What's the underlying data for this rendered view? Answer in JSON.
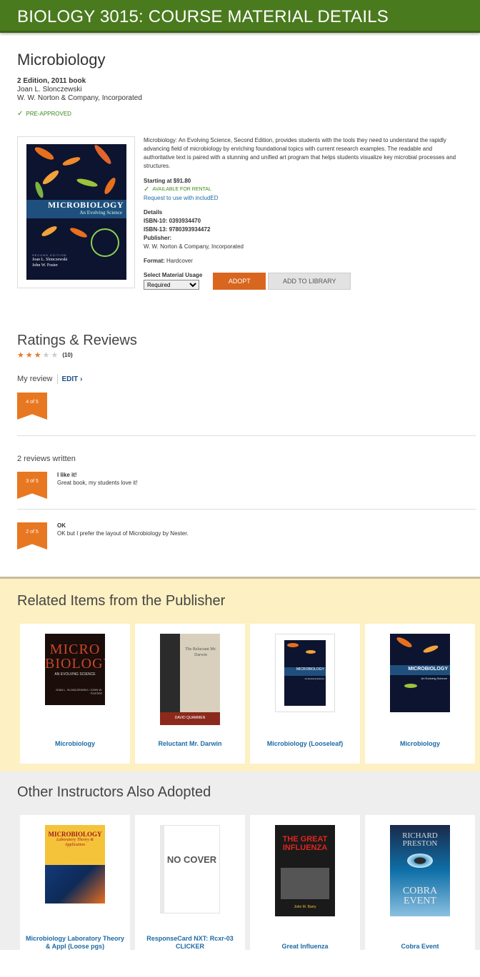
{
  "header": {
    "title": "BIOLOGY 3015: COURSE MATERIAL DETAILS"
  },
  "book": {
    "title": "Microbiology",
    "edition": "2 Edition, 2011 book",
    "author": "Joan L. Slonczewski",
    "publisher": "W. W. Norton & Company, Incorporated",
    "preapproved": "PRE-APPROVED",
    "cover": {
      "title": "MICROBIOLOGY",
      "subtitle": "An Evolving Science",
      "edition": "SECOND EDITION",
      "author1": "Joan L. Slonczewski",
      "author2": "John W. Foster"
    },
    "description": "Microbiology: An Evolving Science, Second Edition, provides students with the tools they need to understand the rapidly advancing field of microbiology by enriching foundational topics with current research examples. The readable and authoritative text is paired with a stunning and unified art program that helps students visualize key microbial processes and structures.",
    "price": "Starting at $91.80",
    "rental": "AVAILABLE FOR RENTAL",
    "includedEd": "Request to use with includED",
    "details_label": "Details",
    "isbn10": "ISBN-10: 0393934470",
    "isbn13": "ISBN-13: 9780393934472",
    "publisher_label": "Publisher:",
    "publisher_value": "W. W. Norton & Company, Incorporated",
    "format_label": "Format:",
    "format_value": "Hardcover",
    "usage_label": "Select Material Usage",
    "usage_value": "Required",
    "adopt": "ADOPT",
    "add_library": "ADD TO LIBRARY"
  },
  "ratings": {
    "title": "Ratings & Reviews",
    "stars": 3,
    "max_stars": 5,
    "count": "(10)",
    "my_review_label": "My review",
    "edit": "EDIT ›",
    "my_rating": "4 of 5",
    "written": "2 reviews written",
    "reviews": [
      {
        "rating": "3 of 5",
        "title": "I like it!",
        "text": "Great book, my students love it!"
      },
      {
        "rating": "2 of 5",
        "title": "OK",
        "text": "OK but I prefer the layout of Microbiology by Nester."
      }
    ]
  },
  "related": {
    "title": "Related Items from the Publisher",
    "items": [
      {
        "name": "Microbiology",
        "cover_title": "MICRO BIOLOGY",
        "cover_sub": "AN EVOLVING SCIENCE",
        "cover_authors": "JOAN L. SLONCZEWSKI / JOHN W. FOSTER"
      },
      {
        "name": "Reluctant Mr. Darwin",
        "cover_title": "The Reluctant Mr. Darwin",
        "cover_authors": "DAVID QUAMMEN"
      },
      {
        "name": "Microbiology (Looseleaf)",
        "cover_title": "MICROBIOLOGY",
        "cover_sub": "An Evolving Science"
      },
      {
        "name": "Microbiology",
        "cover_title": "MICROBIOLOGY",
        "cover_sub": "An Evolving Science"
      }
    ]
  },
  "other": {
    "title": "Other Instructors Also Adopted",
    "items": [
      {
        "name": "Microbiology Laboratory Theory & Appl (Loose pgs)",
        "cover_title": "MICROBIOLOGY",
        "cover_sub": "Laboratory Theory & Application"
      },
      {
        "name": "ResponseCard NXT: Rcxr-03 CLICKER",
        "cover_title": "NO COVER"
      },
      {
        "name": "Great Influenza",
        "cover_title": "THE GREAT INFLUENZA",
        "cover_authors": "John M. Barry"
      },
      {
        "name": "Cobra Event",
        "cover_title": "RICHARD PRESTON",
        "cover_sub": "COBRA EVENT"
      }
    ]
  },
  "colors": {
    "header": "#4a7a1e",
    "accent": "#e87722",
    "link": "#1b6aa5",
    "related_bg": "#fdf0c2",
    "other_bg": "#eeeeee"
  }
}
